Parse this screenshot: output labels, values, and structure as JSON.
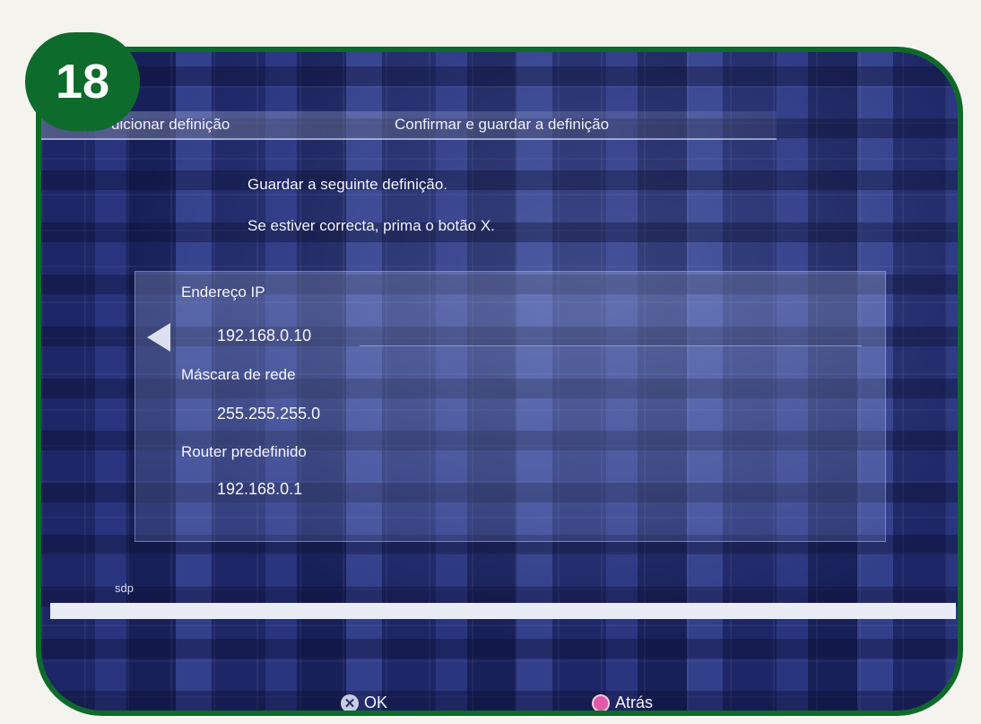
{
  "step_badge": "18",
  "header": {
    "left_label": "dicionar definição",
    "right_label": "Confirmar e guardar a definição"
  },
  "messages": {
    "line1": "Guardar a seguinte definição.",
    "line2": "Se estiver correcta, prima o botão X."
  },
  "settings": [
    {
      "label": "Endereço IP",
      "value": "192.168.0.10"
    },
    {
      "label": "Máscara de rede",
      "value": "255.255.255.0"
    },
    {
      "label": "Router predefinido",
      "value": "192.168.0.1"
    }
  ],
  "footer_small": "sdp",
  "buttons": {
    "ok_label": "OK",
    "back_label": "Atrás"
  },
  "colors": {
    "frame": "#0e6a2a",
    "screen_bg": "#1c2462",
    "circle_button": "#e05aa8"
  },
  "icons": {
    "cross": "cross-button-icon",
    "circle": "circle-button-icon",
    "arrow": "left-arrow-icon"
  }
}
